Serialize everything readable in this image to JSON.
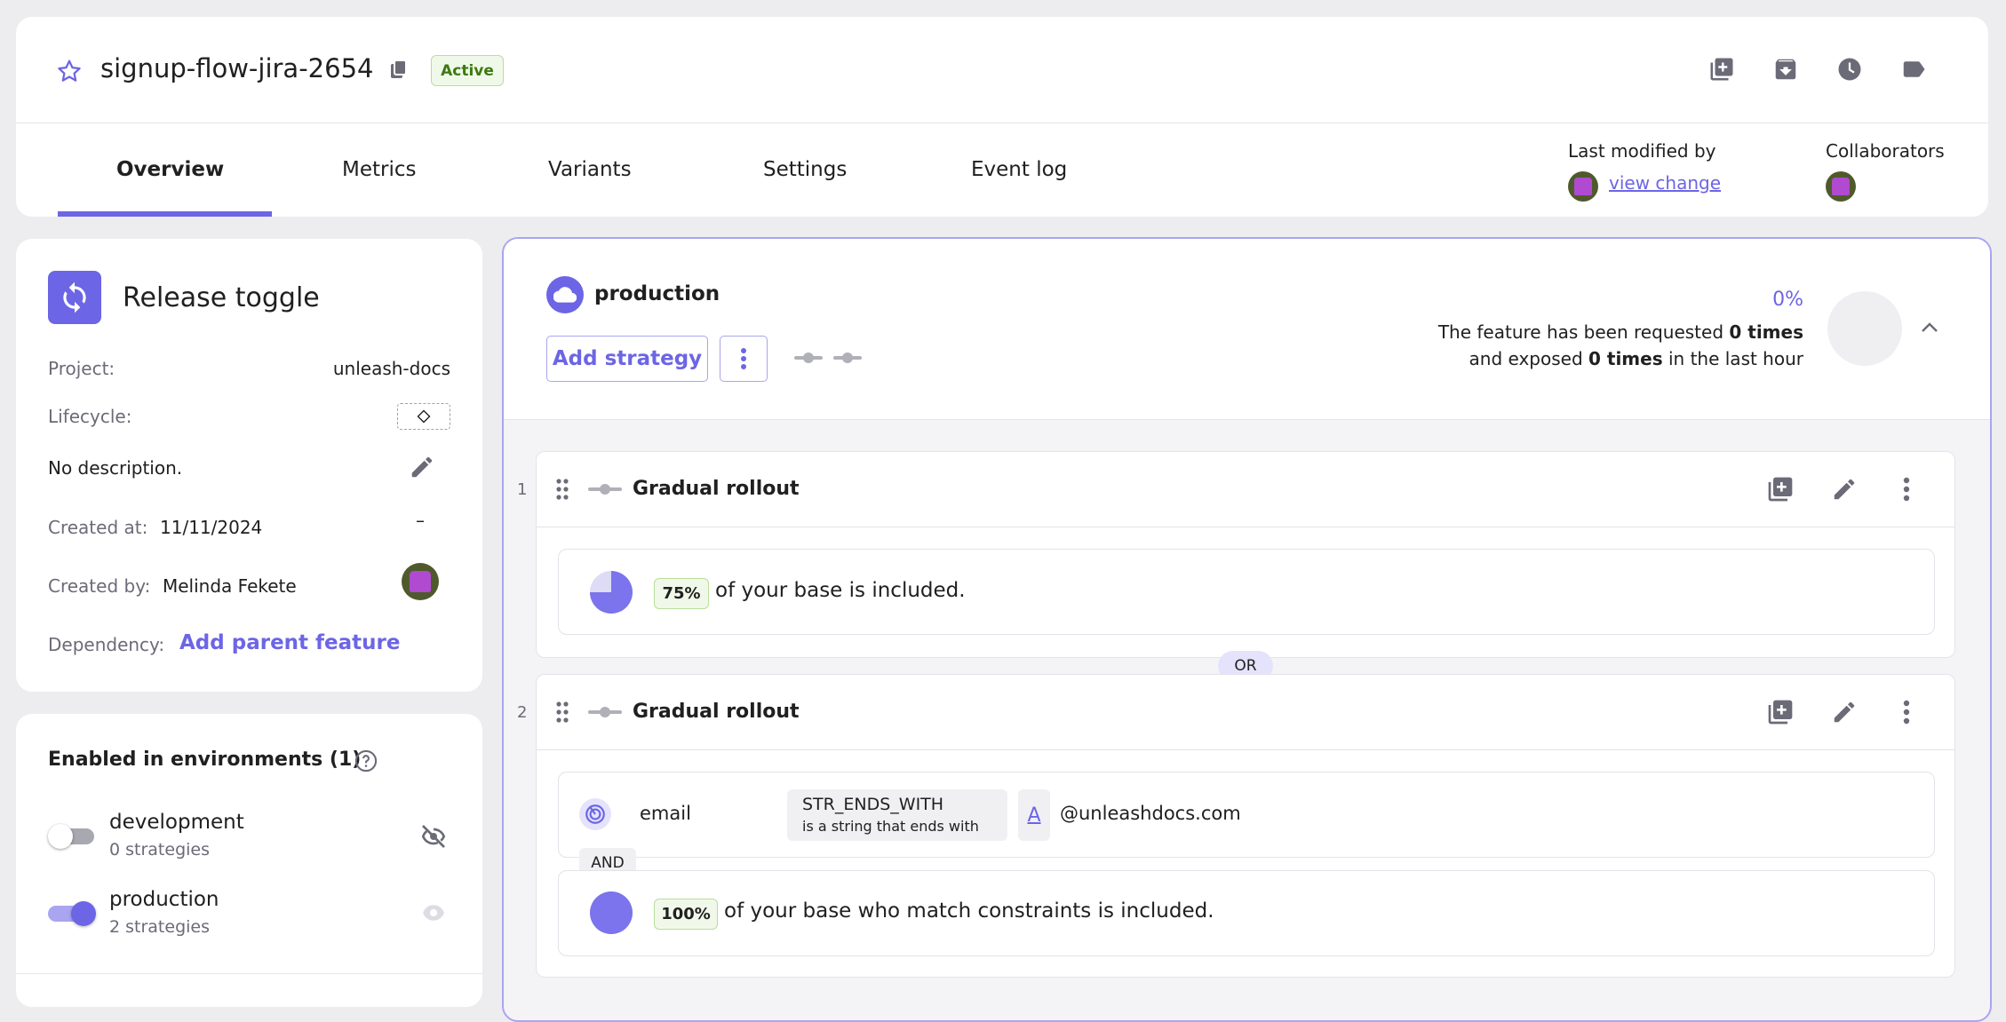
{
  "header": {
    "feature_name": "signup-flow-jira-2654",
    "status_badge": "Active",
    "tabs": [
      "Overview",
      "Metrics",
      "Variants",
      "Settings",
      "Event log"
    ],
    "active_tab_index": 0,
    "last_modified_label": "Last modified by",
    "view_change_link": "view change",
    "collaborators_label": "Collaborators",
    "icons": [
      "star-icon",
      "copy-icon",
      "add-copy-icon",
      "archive-icon",
      "clock-icon",
      "tag-icon"
    ]
  },
  "sidebar": {
    "toggle_type": "Release toggle",
    "project_label": "Project:",
    "project_value": "unleash-docs",
    "lifecycle_label": "Lifecycle:",
    "description": "No description.",
    "created_at_label": "Created at:",
    "created_at_value": "11/11/2024",
    "created_at_extra": "–",
    "created_by_label": "Created by:",
    "created_by_value": "Melinda Fekete",
    "dependency_label": "Dependency:",
    "add_parent_link": "Add parent feature",
    "environments_title": "Enabled in environments (1)",
    "environments": [
      {
        "name": "development",
        "strategies": "0 strategies",
        "enabled": false
      },
      {
        "name": "production",
        "strategies": "2 strategies",
        "enabled": true
      }
    ]
  },
  "environment_panel": {
    "name": "production",
    "add_strategy_label": "Add strategy",
    "percent": "0%",
    "metrics_line1_prefix": "The feature has been requested ",
    "metrics_line1_bold": "0 times",
    "metrics_line2_prefix": "and exposed ",
    "metrics_line2_bold": "0 times",
    "metrics_line2_suffix": " in the last hour",
    "strategies": [
      {
        "index": "1",
        "title": "Gradual rollout",
        "rollout_percent": "75%",
        "rollout_fraction": 0.75,
        "rollout_text": "of your base is included."
      },
      {
        "index": "2",
        "title": "Gradual rollout",
        "constraint_context": "email",
        "constraint_operator": "STR_ENDS_WITH",
        "constraint_operator_desc": "is a string that ends with",
        "constraint_case_icon": "A",
        "constraint_value": "@unleashdocs.com",
        "and_label": "AND",
        "rollout_percent": "100%",
        "rollout_fraction": 1.0,
        "rollout_text": "of your base who match constraints is included."
      }
    ],
    "or_label": "OR"
  },
  "colors": {
    "accent": "#6c65e5",
    "background": "#ededf0",
    "active_badge_bg": "#f0f9e9",
    "active_badge_border": "#b9dd9c",
    "active_badge_text": "#3d7a10"
  }
}
